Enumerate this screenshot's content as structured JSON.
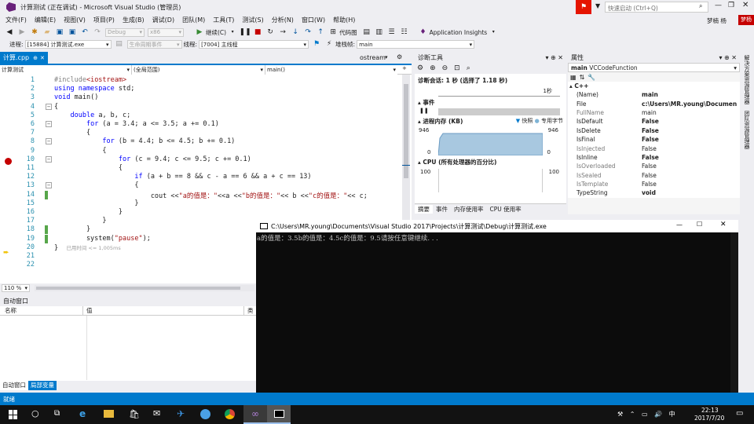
{
  "window": {
    "title": "计算测试 (正在调试) - Microsoft Visual Studio (管理员)",
    "quick_launch_placeholder": "快速启动 (Ctrl+Q)",
    "user": "梦楠 杨",
    "user_badge": "梦杨"
  },
  "menu": [
    "文件(F)",
    "编辑(E)",
    "视图(V)",
    "项目(P)",
    "生成(B)",
    "调试(D)",
    "团队(M)",
    "工具(T)",
    "测试(S)",
    "分析(N)",
    "窗口(W)",
    "帮助(H)"
  ],
  "toolbar": {
    "config": "Debug",
    "platform": "x86",
    "continue_label": "继续(C)",
    "code_map": "代码图",
    "app_insights": "Application Insights"
  },
  "debugbar": {
    "process_label": "进程:",
    "process_value": "[15884] 计算测试.exe",
    "lifecycle_label": "生命周期事件",
    "thread_label": "线程:",
    "thread_value": "[7004] 主线程",
    "stack_label": "堆栈帧:",
    "stack_value": "main"
  },
  "editor": {
    "tabs": [
      "计算.cpp",
      "ostream"
    ],
    "nav": {
      "project": "计算测试",
      "scope": "(全局范围)",
      "func": "main()"
    },
    "zoom": "110 %",
    "lines": [
      {
        "n": "1",
        "html": "<span class=\"pp\">#include</span><span class=\"inc\">&lt;iostream&gt;</span>"
      },
      {
        "n": "2",
        "html": "<span class=\"kw\">using namespace</span> std;"
      },
      {
        "n": "3",
        "html": "<span class=\"kw\">void</span> main()"
      },
      {
        "n": "4",
        "html": "{"
      },
      {
        "n": "5",
        "html": "    <span class=\"kw\">double</span> a, b, c;"
      },
      {
        "n": "6",
        "html": "        <span class=\"kw\">for</span> (a = 3.4; a &lt;= 3.5; a += 0.1)"
      },
      {
        "n": "7",
        "html": "        {"
      },
      {
        "n": "8",
        "html": "            <span class=\"kw\">for</span> (b = 4.4; b &lt;= 4.5; b += 0.1)"
      },
      {
        "n": "9",
        "html": "            {"
      },
      {
        "n": "10",
        "html": "                <span class=\"kw\">for</span> (c = 9.4; c &lt;= 9.5; c += 0.1)"
      },
      {
        "n": "11",
        "html": "                {"
      },
      {
        "n": "12",
        "html": "                    <span class=\"kw\">if</span> (a + b == 8 &amp;&amp; c - a == 6 &amp;&amp; a + c == 13)"
      },
      {
        "n": "13",
        "html": "                    {"
      },
      {
        "n": "14",
        "html": "                        cout &lt;&lt;<span class=\"str\">\"a的值是：\"</span>&lt;&lt;a &lt;&lt;<span class=\"str\">\"b的值是：\"</span>&lt;&lt; b &lt;&lt;<span class=\"str\">\"c的值是：\"</span>&lt;&lt; c;"
      },
      {
        "n": "15",
        "html": "                    }"
      },
      {
        "n": "16",
        "html": "                }"
      },
      {
        "n": "17",
        "html": "            }"
      },
      {
        "n": "18",
        "html": "        }"
      },
      {
        "n": "19",
        "html": "        system(<span class=\"str\">\"pause\"</span>);"
      },
      {
        "n": "20",
        "html": "}  <span style=\"color:#a0a0a0;font-size:6.5px;font-family:'DejaVu Sans',sans-serif\">已用时间 &lt;= 1,005ms</span>"
      },
      {
        "n": "21",
        "html": ""
      },
      {
        "n": "22",
        "html": ""
      }
    ]
  },
  "diagnostics": {
    "title": "诊断工具",
    "session": "诊断会话: 1 秒 (选择了 1.18 秒)",
    "timeline_label": "1秒",
    "events": "事件",
    "memory": "进程内存 (KB)",
    "legend": [
      "快照",
      "专用字节"
    ],
    "mem_max": "946",
    "mem_min": "0",
    "cpu": "CPU (所有处理器的百分比)",
    "cpu_max": "100",
    "tabs": [
      "摘要",
      "事件",
      "内存使用率",
      "CPU 使用率"
    ]
  },
  "properties": {
    "title": "属性",
    "object": "main",
    "object_type": "VCCodeFunction",
    "category": "C++",
    "rows": [
      {
        "k": "(Name)",
        "v": "main",
        "bold": true
      },
      {
        "k": "File",
        "v": "c:\\Users\\MR.young\\Documen",
        "bold": true
      },
      {
        "k": "FullName",
        "v": "main",
        "bold": false
      },
      {
        "k": "IsDefault",
        "v": "False",
        "bold": true
      },
      {
        "k": "IsDelete",
        "v": "False",
        "bold": true
      },
      {
        "k": "IsFinal",
        "v": "False",
        "bold": true
      },
      {
        "k": "IsInjected",
        "v": "False",
        "bold": false
      },
      {
        "k": "IsInline",
        "v": "False",
        "bold": true
      },
      {
        "k": "IsOverloaded",
        "v": "False",
        "bold": false
      },
      {
        "k": "IsSealed",
        "v": "False",
        "bold": false
      },
      {
        "k": "IsTemplate",
        "v": "False",
        "bold": false
      },
      {
        "k": "TypeString",
        "v": "void",
        "bold": true
      }
    ]
  },
  "side_tabs": [
    "解决方案资源管理器",
    "团队资源管理器"
  ],
  "autos": {
    "title": "自动窗口",
    "columns": [
      "名称",
      "值",
      "类"
    ],
    "tabs": [
      "自动窗口",
      "局部变量"
    ]
  },
  "console": {
    "title": "C:\\Users\\MR.young\\Documents\\Visual Studio 2017\\Projects\\计算测试\\Debug\\计算测试.exe",
    "output": "a的值是：3.5b的值是：4.5c的值是：9.5请按任意键继续. . ."
  },
  "status": {
    "text": "就绪"
  },
  "taskbar": {
    "time": "22:13",
    "date": "2017/7/20"
  },
  "colors": {
    "accent": "#007acc",
    "breakpoint": "#c50000",
    "keyword": "#0000ff",
    "string": "#a31515"
  }
}
